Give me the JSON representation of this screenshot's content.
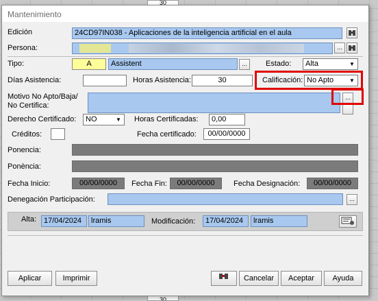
{
  "background": {
    "cell_top": "30",
    "cell_bottom": "30"
  },
  "window": {
    "title": "Mantenimiento"
  },
  "edicion": {
    "label": "Edición",
    "value": "24CD97IN038 - Aplicaciones de la inteligencia artificial en el aula"
  },
  "persona": {
    "label": "Persona:"
  },
  "tipo": {
    "label": "Tipo:",
    "code": "A",
    "name": "Assistent"
  },
  "estado": {
    "label": "Estado:",
    "value": "Alta"
  },
  "dias": {
    "label": "Días Asistencia:",
    "value": ""
  },
  "horas": {
    "label": "Horas Asistencia:",
    "value": "30"
  },
  "calificacion": {
    "label": "Calificación:",
    "value": "No Apto"
  },
  "motivo": {
    "label_line1": "Motivo No Apto/Baja/",
    "label_line2": "No Certifica:"
  },
  "derecho": {
    "label": "Derecho Certificado:",
    "value": "NO"
  },
  "horas_cert": {
    "label": "Horas Certificadas:",
    "value": "0,00"
  },
  "creditos": {
    "label": "Créditos:"
  },
  "fecha_cert": {
    "label": "Fecha certificado:",
    "value": "00/00/0000"
  },
  "ponencia": {
    "label": "Ponencia:"
  },
  "ponencia_ca": {
    "label": "Ponència:"
  },
  "fecha_inicio": {
    "label": "Fecha Inicio:",
    "value": "00/00/0000"
  },
  "fecha_fin": {
    "label": "Fecha Fin:",
    "value": "00/00/0000"
  },
  "fecha_designacion": {
    "label": "Fecha Designación:",
    "value": "00/00/0000"
  },
  "denegacion": {
    "label": "Denegación Participación:"
  },
  "alta": {
    "label": "Alta:",
    "date": "17/04/2024",
    "user": "lramis"
  },
  "modificacion": {
    "label": "Modificación:",
    "date": "17/04/2024",
    "user": "lramis"
  },
  "ellipsis": "...",
  "buttons": {
    "aplicar": "Aplicar",
    "imprimir": "Imprimir",
    "cancelar": "Cancelar",
    "aceptar": "Aceptar",
    "ayuda": "Ayuda"
  },
  "colors": {
    "field_blue": "#a8c8ef",
    "highlight_red": "#e00000",
    "field_yellow": "#fdfd9a",
    "readonly_gray": "#7b7b7b"
  }
}
